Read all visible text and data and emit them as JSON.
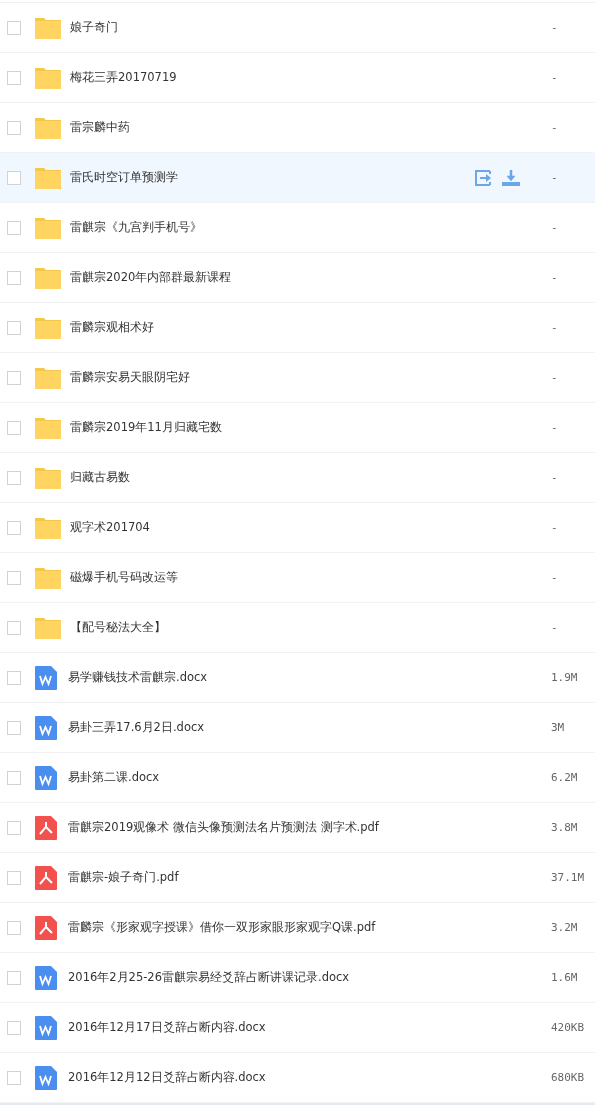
{
  "files": [
    {
      "kind": "folder",
      "name": "娘子奇门",
      "size": "-",
      "checked": false,
      "hovered": false
    },
    {
      "kind": "folder",
      "name": "梅花三弄20170719",
      "size": "-",
      "checked": false,
      "hovered": false
    },
    {
      "kind": "folder",
      "name": "雷宗麟中药",
      "size": "-",
      "checked": false,
      "hovered": false
    },
    {
      "kind": "folder",
      "name": "雷氏时空订单预测学",
      "size": "-",
      "checked": false,
      "hovered": true
    },
    {
      "kind": "folder",
      "name": "雷麒宗《九宫判手机号》",
      "size": "-",
      "checked": false,
      "hovered": false
    },
    {
      "kind": "folder",
      "name": "雷麒宗2020年内部群最新课程",
      "size": "-",
      "checked": false,
      "hovered": false
    },
    {
      "kind": "folder",
      "name": "雷麟宗观相术好",
      "size": "-",
      "checked": false,
      "hovered": false
    },
    {
      "kind": "folder",
      "name": "雷麟宗安易天眼阴宅好",
      "size": "-",
      "checked": false,
      "hovered": false
    },
    {
      "kind": "folder",
      "name": "雷麟宗2019年11月归藏宅数",
      "size": "-",
      "checked": false,
      "hovered": false
    },
    {
      "kind": "folder",
      "name": "归藏古易数",
      "size": "-",
      "checked": false,
      "hovered": false
    },
    {
      "kind": "folder",
      "name": "观字术201704",
      "size": "-",
      "checked": false,
      "hovered": false
    },
    {
      "kind": "folder",
      "name": "磁爆手机号码改运等",
      "size": "-",
      "checked": false,
      "hovered": false
    },
    {
      "kind": "folder",
      "name": "【配号秘法大全】",
      "size": "-",
      "checked": false,
      "hovered": false
    },
    {
      "kind": "word",
      "name": "易学赚钱技术雷麒宗.docx",
      "size": "1.9M",
      "checked": false,
      "hovered": false
    },
    {
      "kind": "word",
      "name": "易卦三弄17.6月2日.docx",
      "size": "3M",
      "checked": false,
      "hovered": false
    },
    {
      "kind": "word",
      "name": "易卦第二课.docx",
      "size": "6.2M",
      "checked": false,
      "hovered": false
    },
    {
      "kind": "pdf",
      "name": "雷麒宗2019观像术 微信头像预测法名片预测法 测字术.pdf",
      "size": "3.8M",
      "checked": false,
      "hovered": false
    },
    {
      "kind": "pdf",
      "name": "雷麒宗-娘子奇门.pdf",
      "size": "37.1M",
      "checked": false,
      "hovered": false
    },
    {
      "kind": "pdf",
      "name": "雷麟宗《形家观字授课》借你一双形家眼形家观字Q课.pdf",
      "size": "3.2M",
      "checked": false,
      "hovered": false
    },
    {
      "kind": "word",
      "name": "2016年2月25-26雷麒宗易经爻辞占断讲课记录.docx",
      "size": "1.6M",
      "checked": false,
      "hovered": false
    },
    {
      "kind": "word",
      "name": "2016年12月17日爻辞占断内容.docx",
      "size": "420KB",
      "checked": false,
      "hovered": false
    },
    {
      "kind": "word",
      "name": "2016年12月12日爻辞占断内容.docx",
      "size": "680KB",
      "checked": false,
      "hovered": false
    }
  ]
}
